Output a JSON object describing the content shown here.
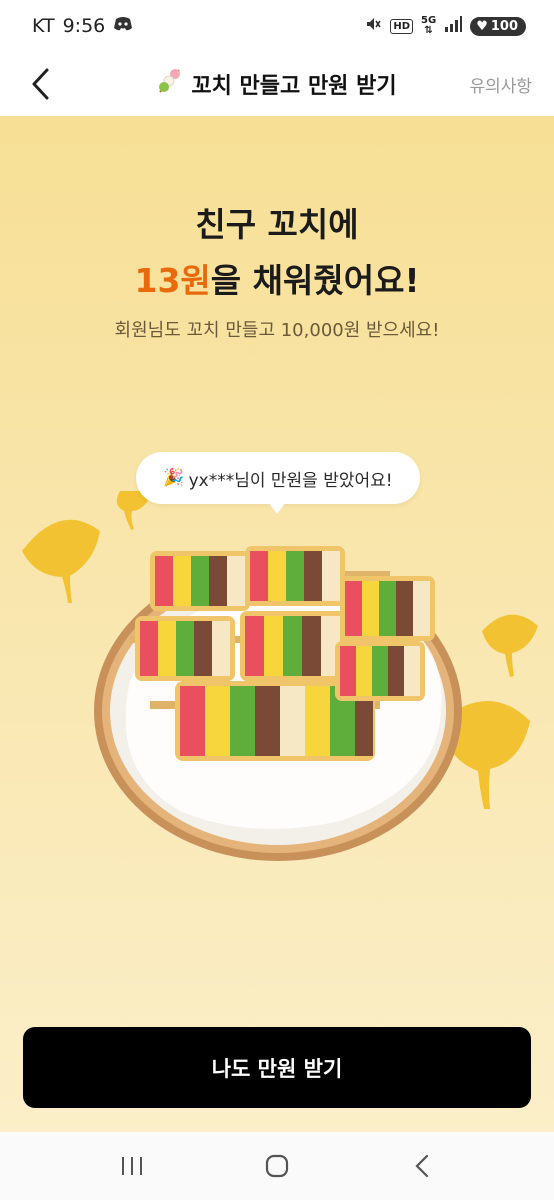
{
  "status_bar": {
    "carrier": "KT",
    "time": "9:56",
    "app_icon": "discord-icon",
    "hd_label": "HD",
    "network_label": "5G",
    "battery_level": "100"
  },
  "header": {
    "title": "꼬치 만들고 만원 받기",
    "title_icon": "skewer-emoji-icon",
    "notice_label": "유의사항"
  },
  "hero": {
    "line1": "친구 꼬치에",
    "amount": "13원",
    "line2_rest": "을 채워줬어요!",
    "subtitle": "회원님도 꼬치 만들고 10,000원 받으세요!",
    "bubble_emoji": "🎉",
    "bubble_text": "yx***님이 만원을 받았어요!"
  },
  "cta": {
    "label": "나도 만원 받기"
  },
  "nav": {
    "recent": "recent-apps-icon",
    "home": "home-icon",
    "back": "back-icon"
  },
  "colors": {
    "accent": "#e96a0d",
    "hero_bg_top": "#f7df95",
    "hero_bg_bottom": "#fbefc9",
    "cta_bg": "#000000"
  }
}
